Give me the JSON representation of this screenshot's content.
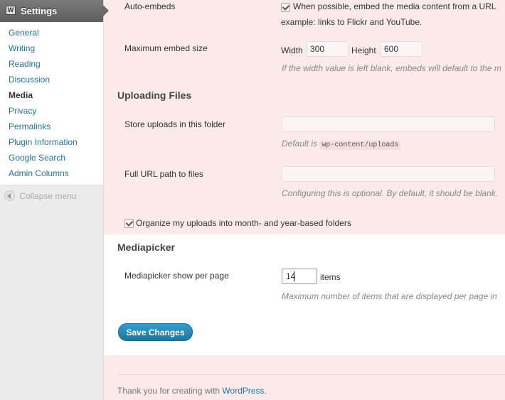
{
  "sidebar": {
    "header_title": "Settings",
    "header_icon": "settings-icon",
    "items": [
      {
        "label": "General"
      },
      {
        "label": "Writing"
      },
      {
        "label": "Reading"
      },
      {
        "label": "Discussion"
      },
      {
        "label": "Media"
      },
      {
        "label": "Privacy"
      },
      {
        "label": "Permalinks"
      },
      {
        "label": "Plugin Information"
      },
      {
        "label": "Google Search"
      },
      {
        "label": "Admin Columns"
      }
    ],
    "current": "Media",
    "collapse_label": "Collapse menu"
  },
  "embeds": {
    "auto_label": "Auto-embeds",
    "auto_checked": true,
    "auto_text_line1": "When possible, embed the media content from a URL",
    "auto_text_line2": "example: links to Flickr and YouTube.",
    "max_label": "Maximum embed size",
    "width_label": "Width",
    "width_value": "300",
    "height_label": "Height",
    "height_value": "600",
    "max_desc": "If the width value is left blank, embeds will default to the m"
  },
  "uploading": {
    "title": "Uploading Files",
    "store_label": "Store uploads in this folder",
    "store_value": "",
    "store_desc_prefix": "Default is",
    "store_desc_code": "wp-content/uploads",
    "url_label": "Full URL path to files",
    "url_value": "",
    "url_desc": "Configuring this is optional. By default, it should be blank.",
    "organize_checked": true,
    "organize_label": "Organize my uploads into month- and year-based folders"
  },
  "mediapicker": {
    "title": "Mediapicker",
    "per_page_label": "Mediapicker show per page",
    "per_page_value": "14",
    "per_page_suffix": "items",
    "per_page_desc": "Maximum number of items that are displayed per page in"
  },
  "save_label": "Save Changes",
  "footer": {
    "text": "Thank you for creating with",
    "link": "WordPress",
    "suffix": "."
  },
  "colors": {
    "link": "#21759b",
    "highlight_bg": "#fdeaea",
    "button": "#21759b"
  }
}
